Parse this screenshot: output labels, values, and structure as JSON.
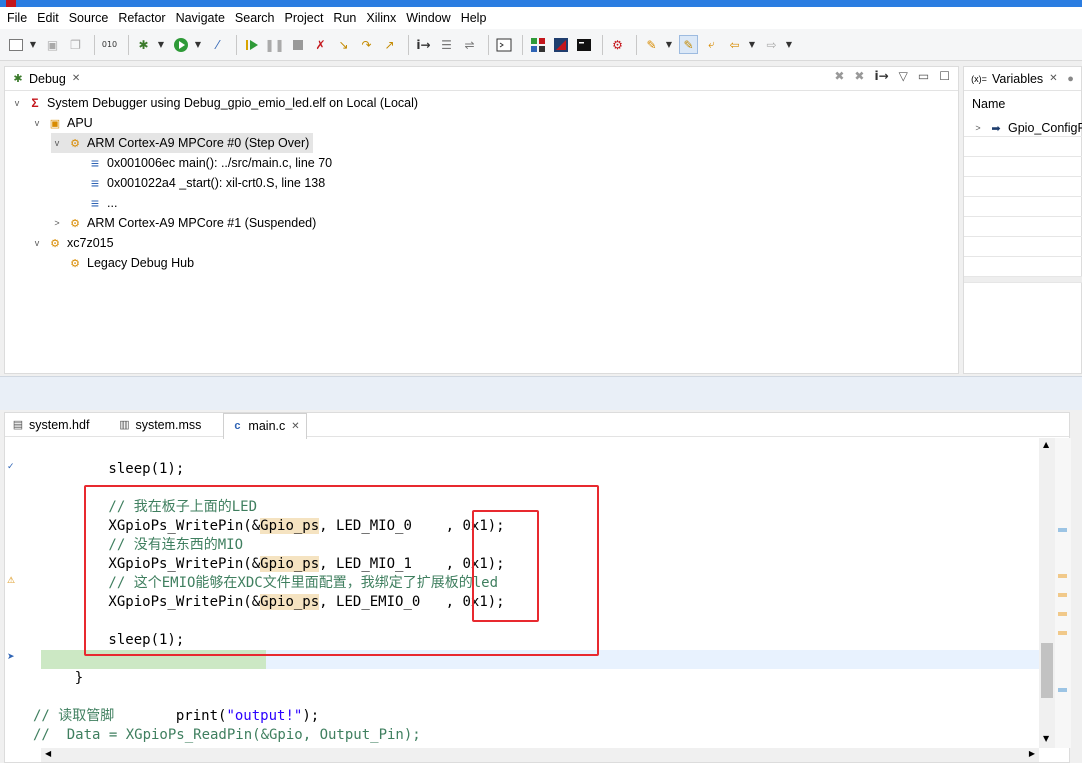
{
  "menu": [
    "File",
    "Edit",
    "Source",
    "Refactor",
    "Navigate",
    "Search",
    "Project",
    "Run",
    "Xilinx",
    "Window",
    "Help"
  ],
  "debug": {
    "tab_label": "Debug",
    "tree": [
      {
        "label": "System Debugger using Debug_gpio_emio_led.elf on Local (Local)",
        "expanded": true,
        "icon": "tcf-icon"
      },
      {
        "label": "APU",
        "expanded": true,
        "icon": "apu-icon"
      },
      {
        "label": "ARM Cortex-A9 MPCore #0 (Step Over)",
        "expanded": true,
        "icon": "core-icon",
        "selected": true
      },
      {
        "label": "0x001006ec main(): ../src/main.c, line 70",
        "icon": "stack-frame-icon"
      },
      {
        "label": "0x001022a4 _start(): xil-crt0.S, line 138",
        "icon": "stack-frame-icon"
      },
      {
        "label": "...",
        "icon": "stack-frame-icon"
      },
      {
        "label": "ARM Cortex-A9 MPCore #1 (Suspended)",
        "expanded": false,
        "icon": "core-icon"
      },
      {
        "label": "xc7z015",
        "expanded": true,
        "icon": "device-icon"
      },
      {
        "label": "Legacy Debug Hub",
        "icon": "debug-hub-icon"
      }
    ]
  },
  "variables": {
    "tab_label": "Variables",
    "column_name": "Name",
    "items": [
      {
        "label": "Gpio_ConfigP"
      }
    ]
  },
  "editor": {
    "tabs": [
      {
        "label": "system.hdf",
        "active": false
      },
      {
        "label": "system.mss",
        "active": false
      },
      {
        "label": "main.c",
        "active": true
      }
    ],
    "lines": {
      "l1": "        sleep(1);",
      "l3_cmt": "        // 我在板子上面的LED",
      "l4_a": "        XGpioPs_WritePin(&",
      "l4_b": "Gpio_ps",
      "l4_c": ", LED_MIO_0    , 0x1);",
      "l5_cmt": "        // 没有连东西的MIO",
      "l6_a": "        XGpioPs_WritePin(&",
      "l6_b": "Gpio_ps",
      "l6_c": ", LED_MIO_1    , 0x1);",
      "l7_cmt": "        // 这个EMIO能够在XDC文件里面配置，我绑定了扩展板的led",
      "l8_a": "        XGpioPs_WritePin(&",
      "l8_b": "Gpio_ps",
      "l8_c": ", LED_EMIO_0   , 0x1);",
      "l10": "        sleep(1);",
      "l11_a": "        print(",
      "l11_b": "\"output!\"",
      "l11_c": ");",
      "l12": "    }",
      "l14_cmt": "// 读取管脚",
      "l15_cmt": "//  Data = XGpioPs_ReadPin(&Gpio, Output_Pin);"
    }
  },
  "colors": {
    "highlight_line": "#cce8c4",
    "comment": "#3f7f5f",
    "string": "#2a00ff",
    "annotation_box": "#e8292f"
  }
}
